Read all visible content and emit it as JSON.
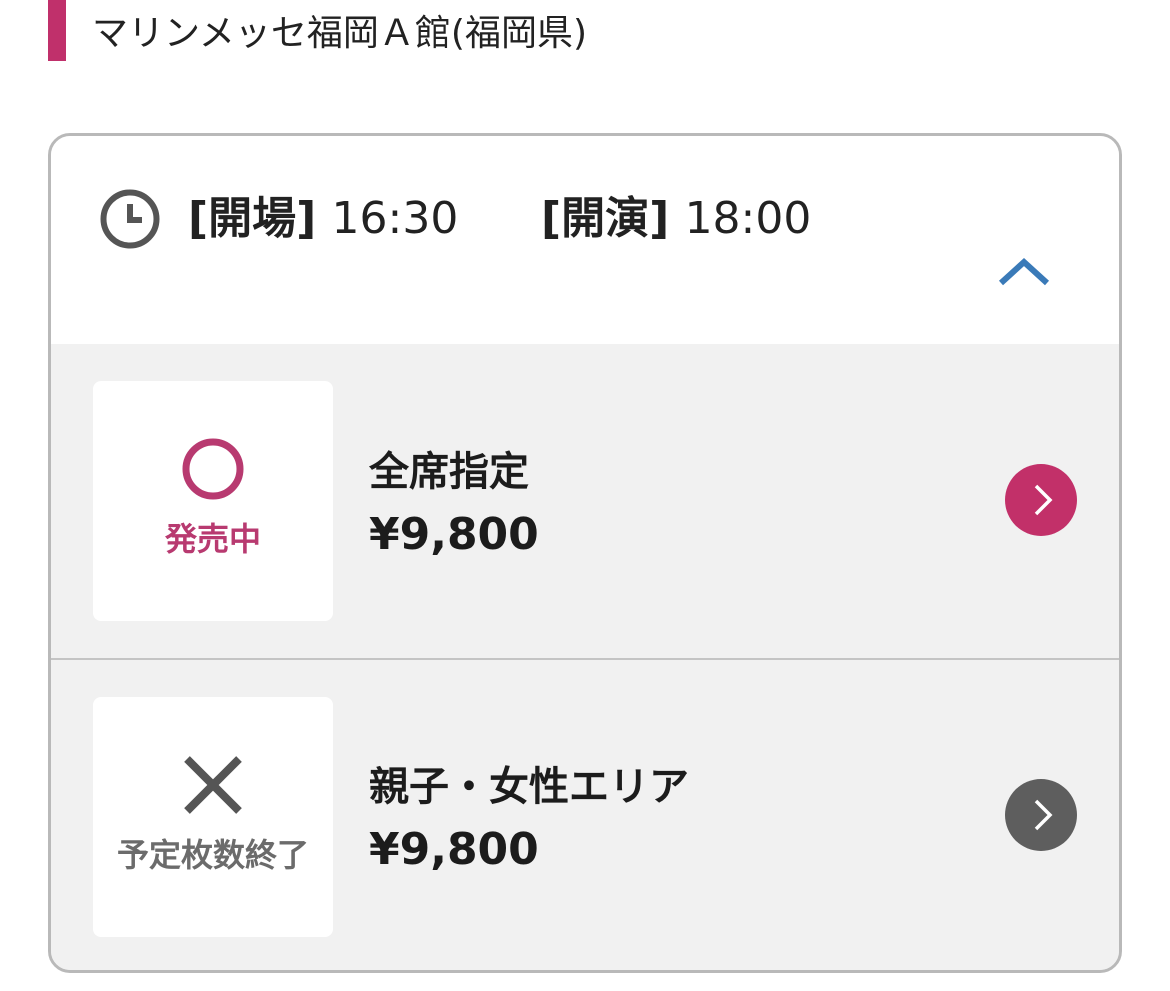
{
  "venue": {
    "name": "マリンメッセ福岡Ａ館(福岡県)",
    "accent_color": "#c0306b"
  },
  "schedule": {
    "open_label": "[開場]",
    "open_time": "16:30",
    "start_label": "[開演]",
    "start_time": "18:00",
    "clock_icon": "clock-icon",
    "collapse_icon": "chevron-up-icon",
    "collapse_color": "#3a7ab8"
  },
  "tickets": [
    {
      "status_symbol": "circle-icon",
      "status_label": "発売中",
      "status_color": "#b83a70",
      "seat_name": "全席指定",
      "price": "¥9,800",
      "arrow_color": "#c23069"
    },
    {
      "status_symbol": "cross-icon",
      "status_label": "予定枚数終了",
      "status_color": "#6b6b6b",
      "seat_name": "親子・女性エリア",
      "price": "¥9,800",
      "arrow_color": "#5e5e5e"
    }
  ]
}
